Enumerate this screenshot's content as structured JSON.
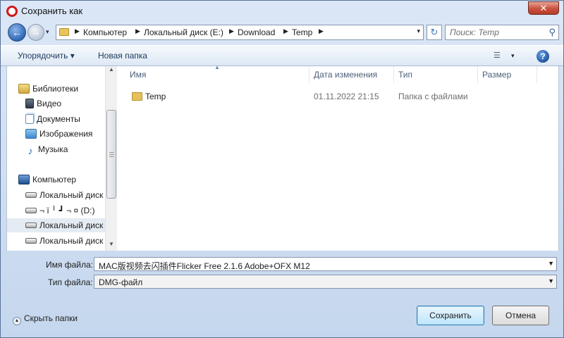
{
  "window": {
    "title": "Сохранить как",
    "close_glyph": "✕"
  },
  "nav": {
    "back_glyph": "←",
    "forward_glyph": "→",
    "history_glyph": "▾",
    "breadcrumbs": [
      "Компьютер",
      "Локальный диск (E:)",
      "Download",
      "Temp"
    ],
    "refresh_glyph": "↻",
    "search_placeholder": "Поиск: Temp",
    "search_glyph": "⚲"
  },
  "toolbar": {
    "organize_label": "Упорядочить ▾",
    "new_folder_label": "Новая папка",
    "view_glyph": "☰",
    "help_glyph": "?"
  },
  "sidebar": {
    "items": [
      {
        "label": "Библиотеки",
        "icon": "library-icon"
      },
      {
        "label": "Видео",
        "icon": "video-icon"
      },
      {
        "label": "Документы",
        "icon": "documents-icon"
      },
      {
        "label": "Изображения",
        "icon": "pictures-icon"
      },
      {
        "label": "Музыка",
        "icon": "music-icon"
      },
      {
        "label": "Компьютер",
        "icon": "computer-icon"
      },
      {
        "label": "Локальный диск",
        "icon": "drive-icon"
      },
      {
        "label": "¬ ї ╵ ┛ ¬ ¤ (D:)",
        "icon": "drive-icon"
      },
      {
        "label": "Локальный диск",
        "icon": "drive-icon"
      },
      {
        "label": "Локальный диск",
        "icon": "drive-icon"
      }
    ]
  },
  "file_list": {
    "columns": [
      "Имя",
      "Дата изменения",
      "Тип",
      "Размер"
    ],
    "rows": [
      {
        "name": "Temp",
        "modified": "01.11.2022 21:15",
        "type": "Папка с файлами",
        "size": ""
      }
    ]
  },
  "form": {
    "filename_label": "Имя файла:",
    "filename_value": "MAC版视频去闪插件Flicker Free 2.1.6 Adobe+OFX M12",
    "filetype_label": "Тип файла:",
    "filetype_value": "DMG-файл"
  },
  "footer": {
    "hide_folders_label": "Скрыть папки",
    "save_label": "Сохранить",
    "cancel_label": "Отмена"
  },
  "colors": {
    "accent": "#3c7fb1",
    "window_bg": "#c9d9ec",
    "close_red": "#c8513d"
  }
}
